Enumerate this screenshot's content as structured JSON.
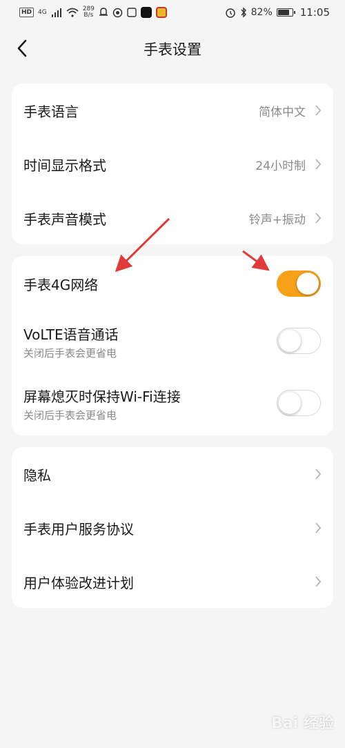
{
  "status_bar": {
    "hd": "HD",
    "network": "4G",
    "speed_value": "289",
    "speed_unit": "B/s",
    "battery": "82%",
    "time": "11:05"
  },
  "header": {
    "title": "手表设置"
  },
  "section1": {
    "language_label": "手表语言",
    "language_value": "简体中文",
    "time_format_label": "时间显示格式",
    "time_format_value": "24小时制",
    "sound_label": "手表声音模式",
    "sound_value": "铃声+振动"
  },
  "section2": {
    "network_label": "手表4G网络",
    "network_on": true,
    "volte_label": "VoLTE语音通话",
    "volte_sub": "关闭后手表会更省电",
    "volte_on": false,
    "wifi_label": "屏幕熄灭时保持Wi-Fi连接",
    "wifi_sub": "关闭后手表会更省电",
    "wifi_on": false
  },
  "section3": {
    "privacy_label": "隐私",
    "agreement_label": "手表用户服务协议",
    "improve_label": "用户体验改进计划"
  },
  "colors": {
    "accent": "#f7a11a",
    "annotation_arrow": "#e03a3a"
  },
  "watermark": "Bai 经验"
}
